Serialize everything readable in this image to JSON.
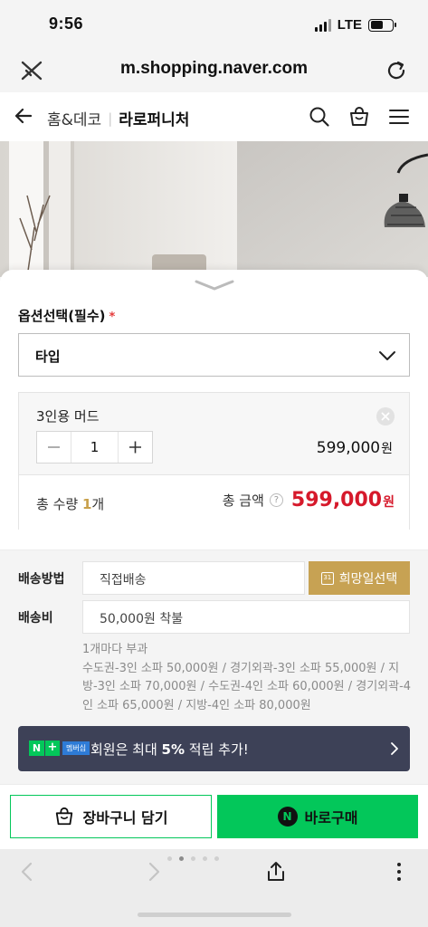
{
  "status_bar": {
    "time": "9:56",
    "network": "LTE"
  },
  "url_bar": {
    "url": "m.shopping.naver.com"
  },
  "header": {
    "breadcrumb_category": "홈&데코",
    "breadcrumb_separator": "|",
    "store_name": "라로퍼니처"
  },
  "option": {
    "title": "옵션선택(필수)",
    "required_mark": "*",
    "select_value": "타입"
  },
  "selected_item": {
    "name": "3인용 머드",
    "quantity": "1",
    "price": "599,000",
    "currency": "원",
    "total_qty_label": "총 수량",
    "total_qty_count": "1",
    "total_qty_unit": "개",
    "total_price_label": "총 금액",
    "help_icon_text": "?",
    "total_price": "599,000",
    "total_currency": "원"
  },
  "shipping": {
    "method_label": "배송방법",
    "method_value": "직접배송",
    "hope_date_button": "희망일선택",
    "calendar_icon_text": "31",
    "fee_label": "배송비",
    "fee_value": "50,000원 착불",
    "note_line1": "1개마다 부과",
    "note_line2": "수도권-3인 소파 50,000원 / 경기외곽-3인 소파 55,000원 / 지방-3인 소파 70,000원 / 수도권-4인 소파 60,000원 / 경기외곽-4인 소파 65,000원 / 지방-4인 소파 80,000원"
  },
  "membership_banner": {
    "badge_n": "N",
    "badge_plus": "+",
    "badge_text": "멤버십",
    "text_prefix": "회원은 최대 ",
    "text_rate": "5%",
    "text_suffix": " 적립 추가!"
  },
  "actions": {
    "cart_label": "장바구니 담기",
    "buy_label": "바로구매",
    "buy_logo": "N"
  },
  "colors": {
    "naver_green": "#03c75a",
    "price_red": "#d6192b",
    "gold": "#c7a253",
    "banner_navy": "#3d4157"
  }
}
